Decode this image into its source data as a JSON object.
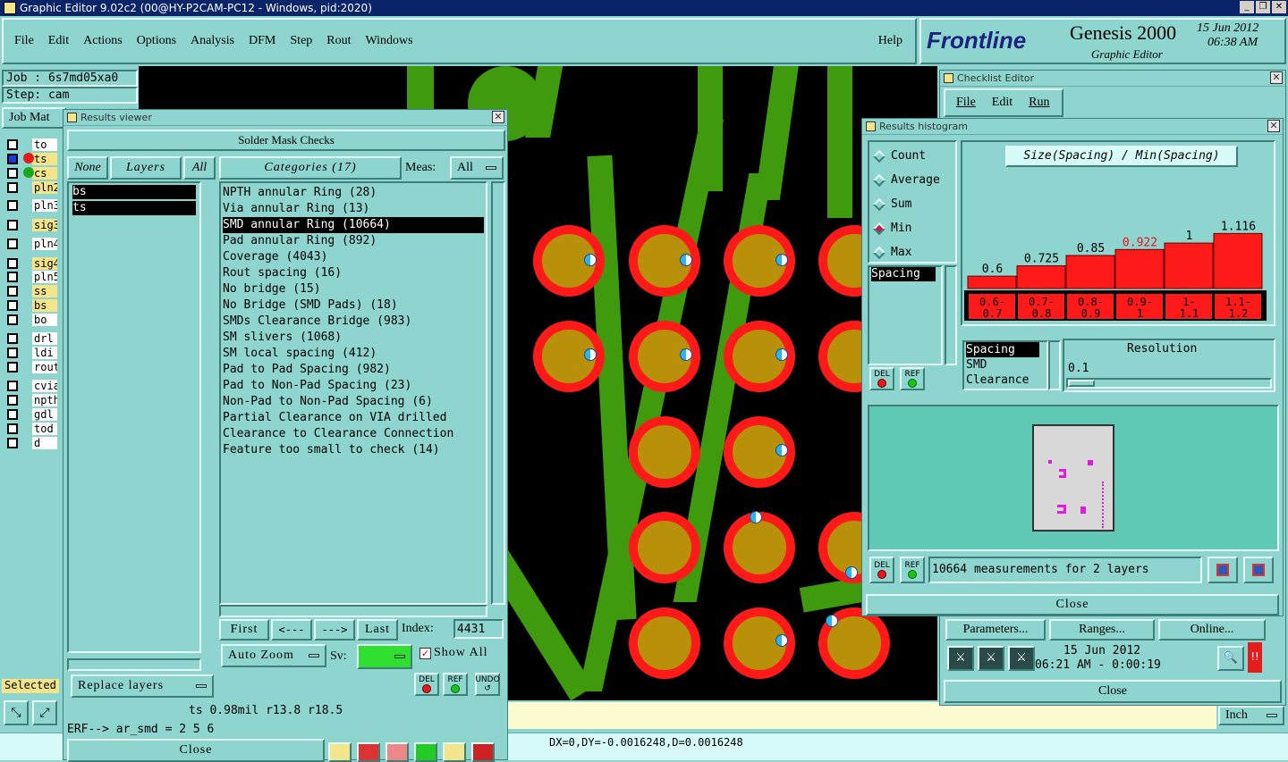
{
  "window_title": "Graphic Editor 9.02c2 (00@HY-P2CAM-PC12 - Windows, pid:2020)",
  "menu": [
    "File",
    "Edit",
    "Actions",
    "Options",
    "Analysis",
    "DFM",
    "Step",
    "Rout",
    "Windows"
  ],
  "help": "Help",
  "brand": {
    "logo": "Frontline",
    "product": "Genesis 2000",
    "subtitle": "Graphic Editor",
    "date": "15 Jun 2012",
    "time": "06:38 AM"
  },
  "job": {
    "job_label": "Job : 6s7md05xa0",
    "step_label": "Step: cam",
    "matrix_btn": "Job Mat"
  },
  "layers": [
    "to",
    "ts",
    "cs",
    "pln2",
    "pln3",
    "sig3",
    "pln4",
    "sig4",
    "pln5",
    "ss",
    "bs",
    "bo",
    "drl",
    "ldi",
    "rout",
    "cvia",
    "npth",
    "gdl",
    "tod",
    "d"
  ],
  "selected_label": "Selected",
  "results_viewer": {
    "title": "Results viewer",
    "header": "Solder Mask Checks",
    "none_btn": "None",
    "layers_btn": "Layers",
    "all_btn": "All",
    "layer_items": [
      "bs",
      "ts"
    ],
    "categories_btn": "Categories (17)",
    "meas_label": "Meas:",
    "meas_value": "All",
    "categories": [
      "NPTH annular Ring (28)",
      "Via annular Ring (13)",
      "SMD annular Ring (10664)",
      "Pad annular Ring (892)",
      "Coverage (4043)",
      "Rout spacing (16)",
      "No bridge (15)",
      "No Bridge (SMD Pads) (18)",
      "SMDs Clearance Bridge (983)",
      "SM slivers (1068)",
      "SM local spacing (412)",
      "Pad to Pad Spacing (982)",
      "Pad to Non-Pad Spacing (23)",
      "Non-Pad to Non-Pad Spacing (6)",
      "Partial Clearance on VIA drilled",
      "Clearance to Clearance Connection",
      "Feature too small to check (14)"
    ],
    "selected_index": 2,
    "first": "First",
    "prev": "<---",
    "next": "--->",
    "last": "Last",
    "index_label": "Index:",
    "index_value": "4431",
    "auto_zoom": "Auto Zoom",
    "sv_label": "Sv:",
    "show_all": "Show All",
    "replace_layers": "Replace layers",
    "del": "DEL",
    "ref": "REF",
    "undo": "UNDO",
    "status": "ts 0.98mil   r13.8   r18.5",
    "erf": "ERF--> ar_smd = 2 5 6",
    "close": "Close"
  },
  "checklist": {
    "title": "Checklist Editor",
    "menu": [
      "File",
      "Edit",
      "Run"
    ],
    "params": "Parameters...",
    "ranges": "Ranges...",
    "online": "Online...",
    "date": "15 Jun 2012",
    "time": "06:21 AM - 0:00:19",
    "close": "Close"
  },
  "histogram": {
    "title": "Results histogram",
    "modes": [
      "Count",
      "Average",
      "Sum",
      "Min",
      "Max"
    ],
    "mode_selected": "Min",
    "chart_title": "Size(Spacing) / Min(Spacing)",
    "list1": [
      "Spacing"
    ],
    "list2": [
      "Spacing",
      "SMD",
      "Clearance"
    ],
    "resolution_label": "Resolution",
    "resolution_value": "0.1",
    "measurements": "10664 measurements for 2 layers",
    "close": "Close",
    "del": "DEL",
    "ref": "REF"
  },
  "chart_data": {
    "type": "bar",
    "title": "Size(Spacing) / Min(Spacing)",
    "categories": [
      "0.6-0.7",
      "0.7-0.8",
      "0.8-0.9",
      "0.9-1",
      "1-1.1",
      "1.1-1.2"
    ],
    "values": [
      0.6,
      0.725,
      0.85,
      0.922,
      1,
      1.116
    ],
    "highlight_index": 3,
    "colors": {
      "bar": "#ff1a1a",
      "highlight_label": "#e8101a"
    }
  },
  "units": "Inch",
  "coords": "DX=0,DY=-0.0016248,D=0.0016248",
  "colors": {
    "panel": "#8fd5cf",
    "pad_copper": "#b8900a",
    "pad_ring": "#ff1a1a",
    "track": "#3f9a0e"
  }
}
